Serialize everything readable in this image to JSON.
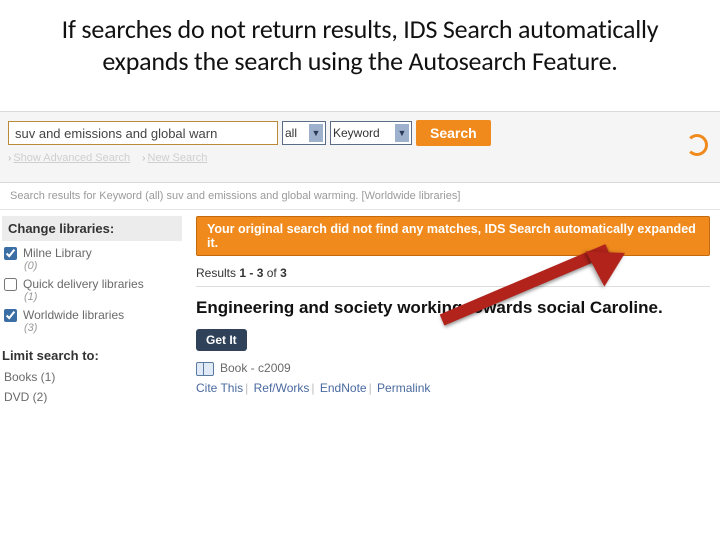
{
  "slide": {
    "title": "If searches do not return results, IDS Search automatically expands the search using the Autosearch Feature."
  },
  "search": {
    "query": "suv and emissions and global warn",
    "scope": "all",
    "field": "Keyword",
    "button": "Search",
    "advanced_label": "Show Advanced Search",
    "new_search_label": "New Search"
  },
  "crumb": "Search results for Keyword (all) suv and emissions and global warming. [Worldwide libraries]",
  "sidebar": {
    "change_label": "Change libraries:",
    "libs": [
      {
        "name": "Milne Library",
        "count": "(0)",
        "checked": true
      },
      {
        "name": "Quick delivery libraries",
        "count": "(1)",
        "checked": false
      },
      {
        "name": "Worldwide libraries",
        "count": "(3)",
        "checked": true
      }
    ],
    "limit_label": "Limit search to:",
    "facets": [
      {
        "label": "Books (1)"
      },
      {
        "label": "DVD (2)"
      }
    ]
  },
  "main": {
    "banner": "Your original search did not find any matches, IDS Search automatically expanded it.",
    "results_prefix": "Results ",
    "results_range": "1 - 3",
    "results_of": " of ",
    "results_total": "3",
    "item_title": "Engineering and society working towards social Caroline.",
    "getit": "Get It",
    "format_label": "Book - c2009",
    "links": {
      "cite": "Cite This",
      "refworks": "Ref/Works",
      "endnote": "EndNote",
      "permalink": "Permalink"
    }
  }
}
